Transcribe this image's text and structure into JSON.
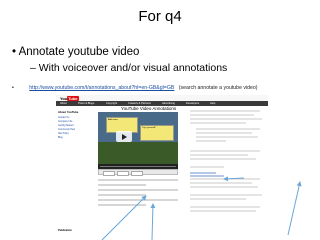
{
  "slide": {
    "title": "For q4",
    "bullet1": "Annotate youtube video",
    "bullet2": "With voiceover and/or visual annotations",
    "bullet3_link": "http://www.youtube.com/t/annotations_about?hl=en-GB&gl=GB",
    "bullet3_hint": "(search annotate a youtube video)"
  },
  "screenshot": {
    "logo": "You",
    "logo_tube": "Tube",
    "nav_items": [
      "About",
      "Press & Blogs",
      "Copyright",
      "Creators & Partners",
      "Advertising",
      "Developers",
      "Help"
    ],
    "side_heading": "About YouTube",
    "side_links": [
      "Contact Us",
      "Company Info",
      "Getting Started",
      "Community Help",
      "Site Policy",
      "Blog"
    ],
    "page_title": "YouTube Video Annotations",
    "note1": "Add notes",
    "note2": "Try it yourself!",
    "publication": "Publication"
  },
  "colors": {
    "link": "#1a4fa0",
    "note": "#f3e778",
    "logo_red": "#dd1111",
    "arrow": "#6aa6d8"
  }
}
